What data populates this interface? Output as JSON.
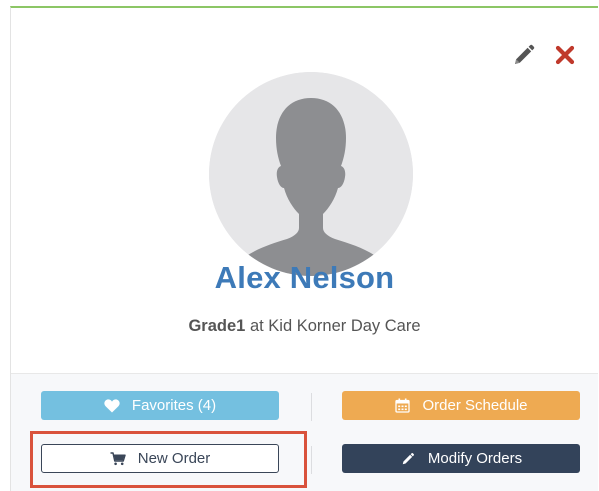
{
  "profile": {
    "name": "Alex Nelson",
    "grade": "Grade1",
    "connector": "at",
    "school": "Kid Korner Day Care",
    "avatar_icon": "user-silhouette-icon"
  },
  "header_actions": {
    "edit_icon": "pencil-icon",
    "delete_icon": "close-icon"
  },
  "buttons": {
    "favorites": {
      "label": "Favorites (4)",
      "icon": "heart-icon",
      "color": "#74c0e0"
    },
    "order_schedule": {
      "label": "Order Schedule",
      "icon": "calendar-icon",
      "color": "#eeaa52"
    },
    "new_order": {
      "label": "New Order",
      "icon": "cart-icon",
      "color": "#ffffff"
    },
    "modify_orders": {
      "label": "Modify Orders",
      "icon": "pencil-icon",
      "color": "#33435a"
    }
  },
  "colors": {
    "name_text": "#3d7ab8",
    "top_border": "#8cc665",
    "highlight": "#d9523c",
    "delete_icon": "#c0392b",
    "edit_icon": "#555555"
  }
}
